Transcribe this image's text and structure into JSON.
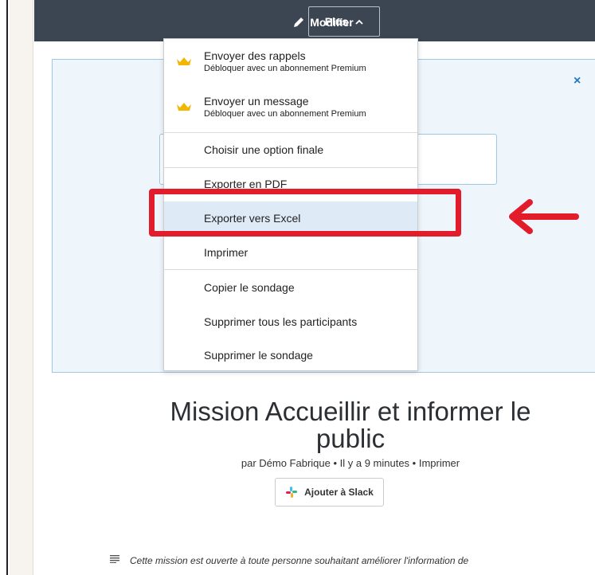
{
  "topbar": {
    "modifier_label": "Modifier",
    "plus_label": "Plus"
  },
  "menu": {
    "premium_items": [
      {
        "label": "Envoyer des rappels",
        "sub": "Débloquer avec un abonnement Premium"
      },
      {
        "label": "Envoyer un message",
        "sub": "Débloquer avec un abonnement Premium"
      }
    ],
    "items": [
      {
        "label": "Choisir une option finale"
      },
      {
        "label": "Exporter en PDF"
      },
      {
        "label": "Exporter vers Excel"
      },
      {
        "label": "Imprimer"
      },
      {
        "label": "Copier le sondage"
      },
      {
        "label": "Supprimer tous les participants"
      },
      {
        "label": "Supprimer le sondage"
      }
    ]
  },
  "poll": {
    "title_line1": "Mission Accueillir et informer le",
    "title_line2": "public",
    "byline": "par Démo Fabrique • Il y a 9 minutes • Imprimer",
    "slack_label": "Ajouter à Slack",
    "description": "Cette mission est ouverte à toute personne souhaitant améliorer l'information de"
  },
  "panel": {
    "close_glyph": "×"
  },
  "colors": {
    "topbar": "#3c4653",
    "highlight": "#deebf7",
    "annotation_red": "#e31c2c",
    "crown": "#f2b705"
  }
}
